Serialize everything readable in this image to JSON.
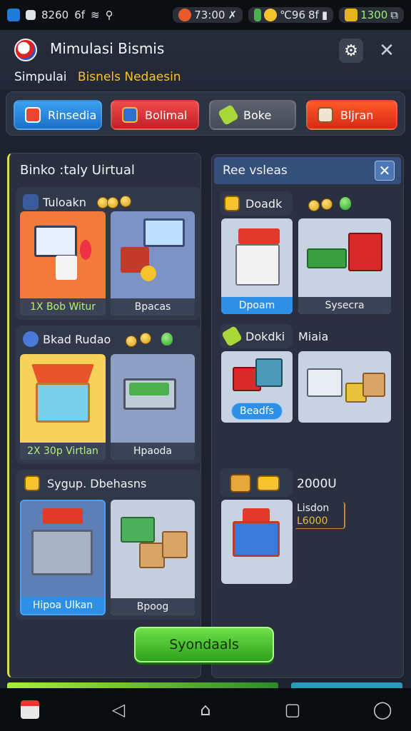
{
  "status_bar": {
    "left_text": "8260",
    "left_text2": "6f",
    "chip1": "73:00",
    "chip2": "℃96",
    "chip2b": "8f",
    "chip3": "1300"
  },
  "header": {
    "title": "Mimulasi Bismis",
    "subtitle": "Simpulai",
    "subtitle_accent": "Bisnels Nedaesin"
  },
  "modes": [
    {
      "label": "Rinsedia",
      "color": "#1d6fc6"
    },
    {
      "label": "Bolimal",
      "color": "#c21f28"
    },
    {
      "label": "Boke",
      "color": "#454a56"
    },
    {
      "label": "Bljran",
      "color": "#d62a14"
    }
  ],
  "left_panel": {
    "title": "Binko :taly Uirtual",
    "sections": [
      {
        "title": "Tuloakn",
        "cards": [
          {
            "caption": "1X Bob Witur"
          },
          {
            "caption": "Bpacas"
          }
        ]
      },
      {
        "title": "Bkad Rudao",
        "cards": [
          {
            "caption": "2X 30p Virtlan"
          },
          {
            "caption": "Hpaoda"
          }
        ]
      },
      {
        "title": "Sygup. Dbehasns",
        "cards": [
          {
            "caption": "Hipoa Ulkan"
          },
          {
            "caption": "Bpoog"
          }
        ]
      }
    ]
  },
  "right_panel": {
    "title": "Ree vsleas",
    "sections": [
      {
        "title": "Doadk",
        "cards": [
          {
            "caption": "Dpoam"
          },
          {
            "caption": "Sysecra"
          }
        ]
      },
      {
        "title": "Dokdki",
        "title2": "Miaia",
        "cards": [
          {
            "caption": "Beadfs"
          },
          {
            "caption": ""
          }
        ]
      },
      {
        "price": "2000U",
        "label_a": "Lisdon",
        "label_b": "L6000"
      }
    ]
  },
  "cta": {
    "label": "Syondaals"
  }
}
